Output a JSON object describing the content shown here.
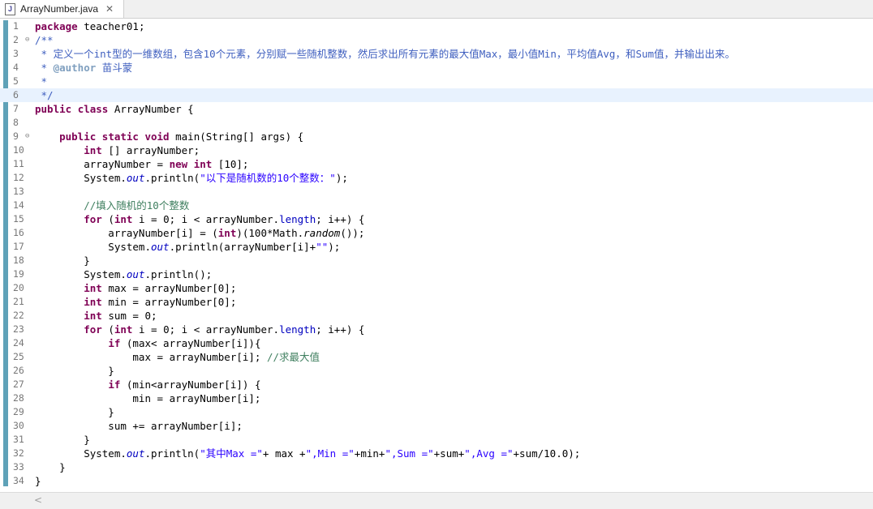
{
  "tab": {
    "title": "ArrayNumber.java",
    "icon": "java-file-icon",
    "close": "✕"
  },
  "editor": {
    "lines": [
      {
        "n": "1",
        "fold": "",
        "html": "<span class=\"kw\">package</span> teacher01;"
      },
      {
        "n": "2",
        "fold": "⊖",
        "html": "<span class=\"jd\">/**</span>"
      },
      {
        "n": "3",
        "fold": "",
        "html": "<span class=\"jd\"> * 定义一个int型的一维数组，包含10个元素，分别赋一些随机整数，然后求出所有元素的最大值Max，最小值Min，平均值Avg，和Sum值，并输出出来。</span>"
      },
      {
        "n": "4",
        "fold": "",
        "html": "<span class=\"jd\"> * </span><span class=\"jtag\">@author</span><span class=\"jd\"> 苗斗蒙</span>"
      },
      {
        "n": "5",
        "fold": "",
        "html": "<span class=\"jd\"> *</span>"
      },
      {
        "n": "6",
        "fold": "",
        "current": true,
        "html": "<span class=\"jd\"> */</span>"
      },
      {
        "n": "7",
        "fold": "",
        "html": "<span class=\"kw\">public</span> <span class=\"kw\">class</span> ArrayNumber {"
      },
      {
        "n": "8",
        "fold": "",
        "html": ""
      },
      {
        "n": "9",
        "fold": "⊖",
        "html": "    <span class=\"kw\">public</span> <span class=\"kw\">static</span> <span class=\"kw\">void</span> main(String[] args) {"
      },
      {
        "n": "10",
        "fold": "",
        "html": "        <span class=\"kw\">int</span> [] arrayNumber;"
      },
      {
        "n": "11",
        "fold": "",
        "html": "        arrayNumber = <span class=\"kw\">new</span> <span class=\"kw\">int</span> [10];"
      },
      {
        "n": "12",
        "fold": "",
        "html": "        System.<span class=\"sfld\">out</span>.println(<span class=\"str\">\"以下是随机数的10个整数：\"</span>);"
      },
      {
        "n": "13",
        "fold": "",
        "html": ""
      },
      {
        "n": "14",
        "fold": "",
        "html": "        <span class=\"cm\">//填入随机的10个整数</span>"
      },
      {
        "n": "15",
        "fold": "",
        "html": "        <span class=\"kw\">for</span> (<span class=\"kw\">int</span> i = 0; i &lt; arrayNumber.<span class=\"fld\">length</span>; i++) {"
      },
      {
        "n": "16",
        "fold": "",
        "html": "            arrayNumber[i] = (<span class=\"kw\">int</span>)(100*Math.<span class=\"smeth\">random</span>());"
      },
      {
        "n": "17",
        "fold": "",
        "html": "            System.<span class=\"sfld\">out</span>.println(arrayNumber[i]+<span class=\"str\">\"\"</span>);"
      },
      {
        "n": "18",
        "fold": "",
        "html": "        }"
      },
      {
        "n": "19",
        "fold": "",
        "html": "        System.<span class=\"sfld\">out</span>.println();"
      },
      {
        "n": "20",
        "fold": "",
        "html": "        <span class=\"kw\">int</span> max = arrayNumber[0];"
      },
      {
        "n": "21",
        "fold": "",
        "html": "        <span class=\"kw\">int</span> min = arrayNumber[0];"
      },
      {
        "n": "22",
        "fold": "",
        "html": "        <span class=\"kw\">int</span> sum = 0;"
      },
      {
        "n": "23",
        "fold": "",
        "html": "        <span class=\"kw\">for</span> (<span class=\"kw\">int</span> i = 0; i &lt; arrayNumber.<span class=\"fld\">length</span>; i++) {"
      },
      {
        "n": "24",
        "fold": "",
        "html": "            <span class=\"kw\">if</span> (max&lt; arrayNumber[i]){"
      },
      {
        "n": "25",
        "fold": "",
        "html": "                max = arrayNumber[i]; <span class=\"cm\">//求最大值</span>"
      },
      {
        "n": "26",
        "fold": "",
        "html": "            }"
      },
      {
        "n": "27",
        "fold": "",
        "html": "            <span class=\"kw\">if</span> (min&lt;arrayNumber[i]) {"
      },
      {
        "n": "28",
        "fold": "",
        "html": "                min = arrayNumber[i];"
      },
      {
        "n": "29",
        "fold": "",
        "html": "            }"
      },
      {
        "n": "30",
        "fold": "",
        "html": "            sum += arrayNumber[i];"
      },
      {
        "n": "31",
        "fold": "",
        "html": "        }"
      },
      {
        "n": "32",
        "fold": "",
        "html": "        System.<span class=\"sfld\">out</span>.println(<span class=\"str\">\"其中Max =\"</span>+ max +<span class=\"str\">\",Min =\"</span>+min+<span class=\"str\">\",Sum =\"</span>+sum+<span class=\"str\">\",Avg =\"</span>+sum/10.0);"
      },
      {
        "n": "33",
        "fold": "",
        "html": "    }"
      },
      {
        "n": "34",
        "fold": "",
        "html": "}"
      }
    ]
  },
  "scrollbar": {
    "left_arrow": "<"
  }
}
